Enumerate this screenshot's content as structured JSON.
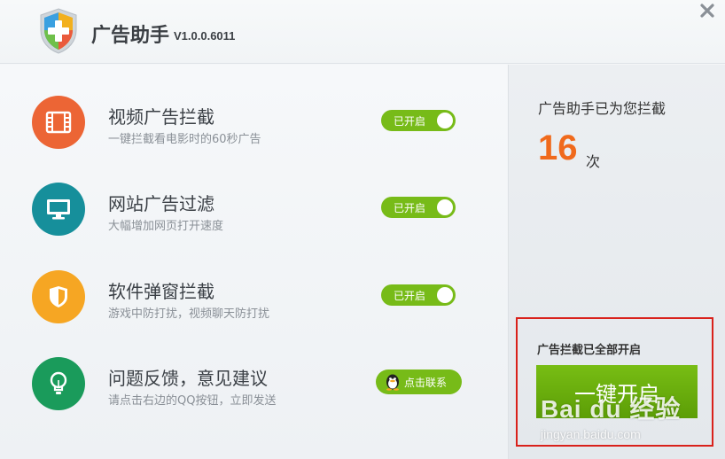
{
  "header": {
    "title": "广告助手",
    "version": "V1.0.0.6011",
    "close_glyph": "✕"
  },
  "features": [
    {
      "title": "视频广告拦截",
      "desc": "一键拦截看电影时的60秒广告",
      "icon": "film-icon",
      "color": "#ec6535",
      "toggle_label": "已开启",
      "enabled": true
    },
    {
      "title": "网站广告过滤",
      "desc": "大幅增加网页打开速度",
      "icon": "monitor-icon",
      "color": "#168f9b",
      "toggle_label": "已开启",
      "enabled": true
    },
    {
      "title": "软件弹窗拦截",
      "desc": "游戏中防打扰，视频聊天防打扰",
      "icon": "shield-icon",
      "color": "#f6a623",
      "toggle_label": "已开启",
      "enabled": true
    },
    {
      "title": "问题反馈，意见建议",
      "desc": "请点击右边的QQ按钮，立即发送",
      "icon": "lightbulb-icon",
      "color": "#1a9b5b",
      "button_label": "点击联系"
    }
  ],
  "stats": {
    "label": "广告助手已为您拦截",
    "count": "16",
    "unit": "次"
  },
  "onekey": {
    "status_label": "广告拦截已全部开启",
    "button_label": "一键开启"
  },
  "watermark": {
    "main": "Bai du 经验",
    "url": "jingyan.baidu.com"
  },
  "colors": {
    "accent_green": "#77bb18",
    "count_orange": "#f06a1c",
    "highlight_red": "#d9211b"
  }
}
